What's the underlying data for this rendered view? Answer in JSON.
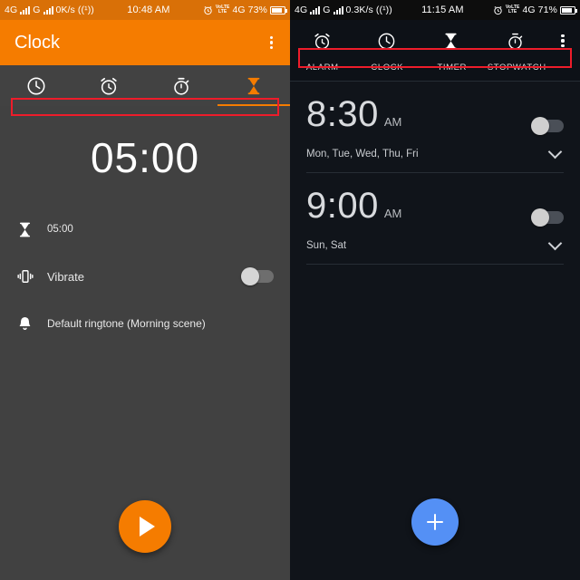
{
  "left": {
    "status_bar": {
      "network_type_1": "4G",
      "network_type_2": "G",
      "data_rate": "0K/s",
      "hotspot_icon": "hotspot-icon",
      "time": "10:48 AM",
      "alarm_icon": "alarm-clock-icon",
      "volte_line1": "VoLTE",
      "volte_line2": "LTE",
      "network_type_3": "4G",
      "battery_percent": "73%"
    },
    "appbar": {
      "title": "Clock",
      "overflow_icon": "more-vertical-icon"
    },
    "tabs": [
      {
        "name": "clock",
        "icon": "clock-icon",
        "selected": false
      },
      {
        "name": "alarm",
        "icon": "alarm-icon",
        "selected": false
      },
      {
        "name": "stopwatch",
        "icon": "stopwatch-icon",
        "selected": false
      },
      {
        "name": "timer",
        "icon": "hourglass-icon",
        "selected": true
      }
    ],
    "timer": {
      "display": "05:00",
      "duration_row": {
        "icon": "hourglass-icon",
        "label": "05:00"
      },
      "vibrate_row": {
        "icon": "vibrate-icon",
        "label": "Vibrate",
        "enabled": false
      },
      "ringtone_row": {
        "icon": "bell-icon",
        "label": "Default ringtone (Morning scene)"
      }
    },
    "fab": {
      "icon": "play-icon",
      "color": "#f57c00"
    }
  },
  "right": {
    "status_bar": {
      "network_type_1": "4G",
      "network_type_2": "G",
      "data_rate": "0.3K/s",
      "hotspot_icon": "hotspot-icon",
      "time": "11:15 AM",
      "alarm_icon": "alarm-clock-icon",
      "volte_line1": "VoLTE",
      "volte_line2": "LTE",
      "network_type_3": "4G",
      "battery_percent": "71%"
    },
    "tabs": [
      {
        "label": "ALARM",
        "icon": "alarm-icon",
        "selected": true
      },
      {
        "label": "CLOCK",
        "icon": "clock-icon",
        "selected": false
      },
      {
        "label": "TIMER",
        "icon": "hourglass-icon",
        "selected": false
      },
      {
        "label": "STOPWATCH",
        "icon": "stopwatch-icon",
        "selected": false
      }
    ],
    "overflow_icon": "more-vertical-icon",
    "alarms": [
      {
        "time": "8:30",
        "ampm": "AM",
        "days": "Mon, Tue, Wed, Thu, Fri",
        "enabled": false,
        "expand_icon": "chevron-down-icon"
      },
      {
        "time": "9:00",
        "ampm": "AM",
        "days": "Sun, Sat",
        "enabled": false,
        "expand_icon": "chevron-down-icon"
      }
    ],
    "fab": {
      "icon": "plus-icon",
      "color": "#5490f5"
    }
  },
  "annotations": {
    "highlight_color": "#ee1c2a",
    "boxes": [
      {
        "name": "left-tab-indicator-highlight"
      },
      {
        "name": "right-tab-labels-highlight"
      }
    ]
  }
}
